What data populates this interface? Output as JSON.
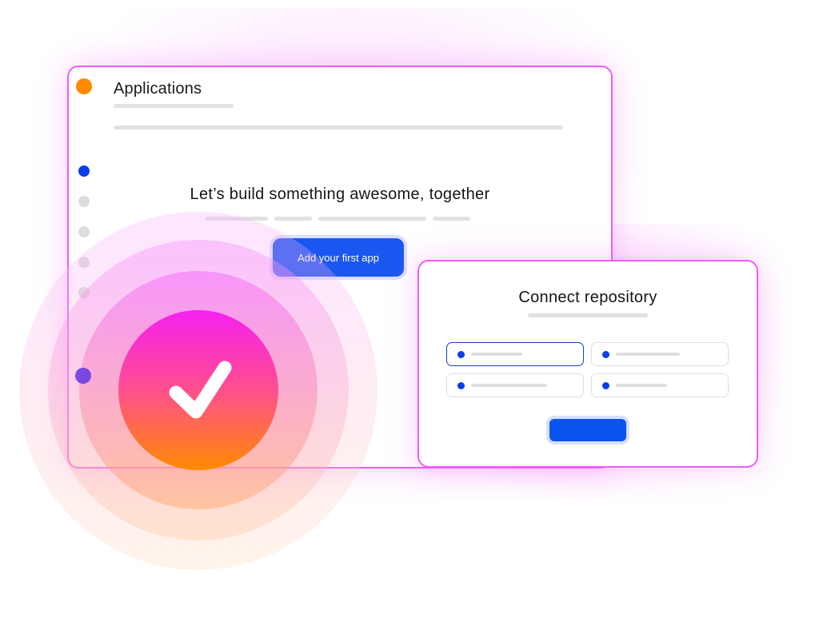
{
  "applications_window": {
    "title": "Applications",
    "headline": "Let’s build something awesome, together",
    "add_button_label": "Add your first app",
    "steps": [
      "active",
      "inactive",
      "inactive",
      "inactive",
      "inactive"
    ]
  },
  "repository_window": {
    "title": "Connect repository",
    "options": [
      {
        "selected": true
      },
      {
        "selected": false
      },
      {
        "selected": false
      },
      {
        "selected": false
      }
    ]
  },
  "badge": {
    "icon": "checkmark-icon"
  },
  "colors": {
    "accent_blue": "#1a56f0",
    "border_pink": "#f05cf8",
    "orange": "#ff8a00",
    "magenta": "#f520f0"
  }
}
